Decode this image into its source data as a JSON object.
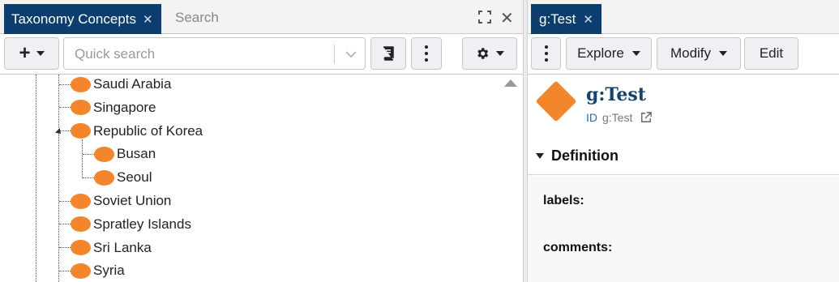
{
  "left_panel": {
    "tab_label": "Taxonomy Concepts",
    "tab_close": "✕",
    "search_tab": "Search",
    "close_glyph": "✕",
    "quick_search_placeholder": "Quick search",
    "add_label": "+",
    "tree": [
      {
        "label": "Saudi Arabia",
        "level": 1
      },
      {
        "label": "Singapore",
        "level": 1
      },
      {
        "label": "Republic of Korea",
        "level": 1,
        "expanded": true
      },
      {
        "label": "Busan",
        "level": 2
      },
      {
        "label": "Seoul",
        "level": 2
      },
      {
        "label": "Soviet Union",
        "level": 1
      },
      {
        "label": "Spratley Islands",
        "level": 1
      },
      {
        "label": "Sri Lanka",
        "level": 1
      },
      {
        "label": "Syria",
        "level": 1
      }
    ]
  },
  "right_panel": {
    "tab_label": "g:Test",
    "tab_close": "✕",
    "explore_label": "Explore",
    "modify_label": "Modify",
    "edit_label": "Edit",
    "concept_title": "g:Test",
    "id_key": "ID",
    "id_value": "g:Test",
    "definition_header": "Definition",
    "fields": {
      "labels": "labels:",
      "comments": "comments:"
    }
  },
  "colors": {
    "tab_bg": "#0b3e6e",
    "concept_orange": "#f3862a",
    "title_blue": "#14446e"
  },
  "icons": [
    "close-icon",
    "expand-icon",
    "chevron-down-icon",
    "book-icon",
    "kebab-icon",
    "gear-icon",
    "external-link-icon",
    "concept-icon"
  ]
}
